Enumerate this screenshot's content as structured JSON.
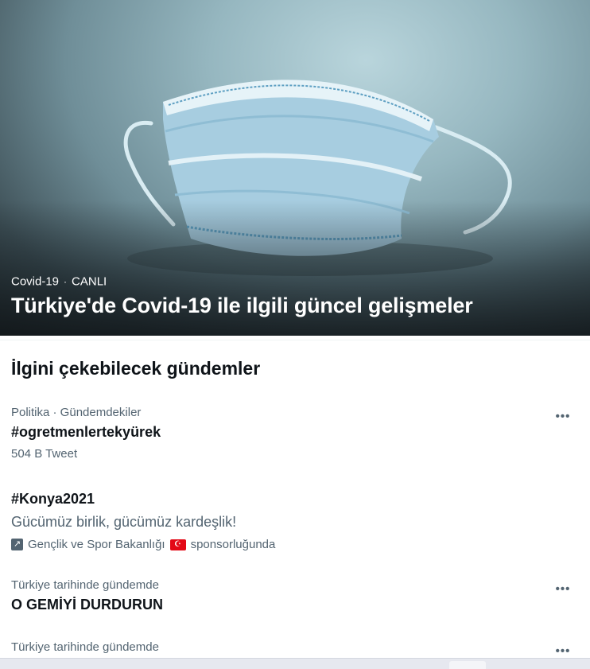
{
  "hero": {
    "category": "Covid-19",
    "separator": "·",
    "status": "CANLI",
    "title": "Türkiye'de Covid-19 ile ilgili güncel gelişmeler"
  },
  "section": {
    "title": "İlgini çekebilecek gündemler"
  },
  "trends": [
    {
      "meta": "Politika · Gündemdekiler",
      "name": "#ogretmenlertekyürek",
      "count": "504 B Tweet",
      "more": "•••"
    },
    {
      "name": "#Konya2021",
      "description": "Gücümüz birlik, gücümüz kardeşlik!",
      "promo_icon": "↗",
      "sponsor": "Gençlik ve Spor Bakanlığı",
      "flag_icon": "turkey-flag-icon",
      "flag_glyph": "☪",
      "promo_suffix": "sponsorluğunda"
    },
    {
      "meta": "Türkiye tarihinde gündemde",
      "name": "O GEMİYİ DURDURUN",
      "more": "•••"
    },
    {
      "meta": "Türkiye tarihinde gündemde",
      "more": "•••"
    }
  ],
  "colors": {
    "primary_text": "#0f1419",
    "secondary_text": "#536471",
    "divider": "#eff3f4",
    "flag_red": "#e30a17"
  }
}
